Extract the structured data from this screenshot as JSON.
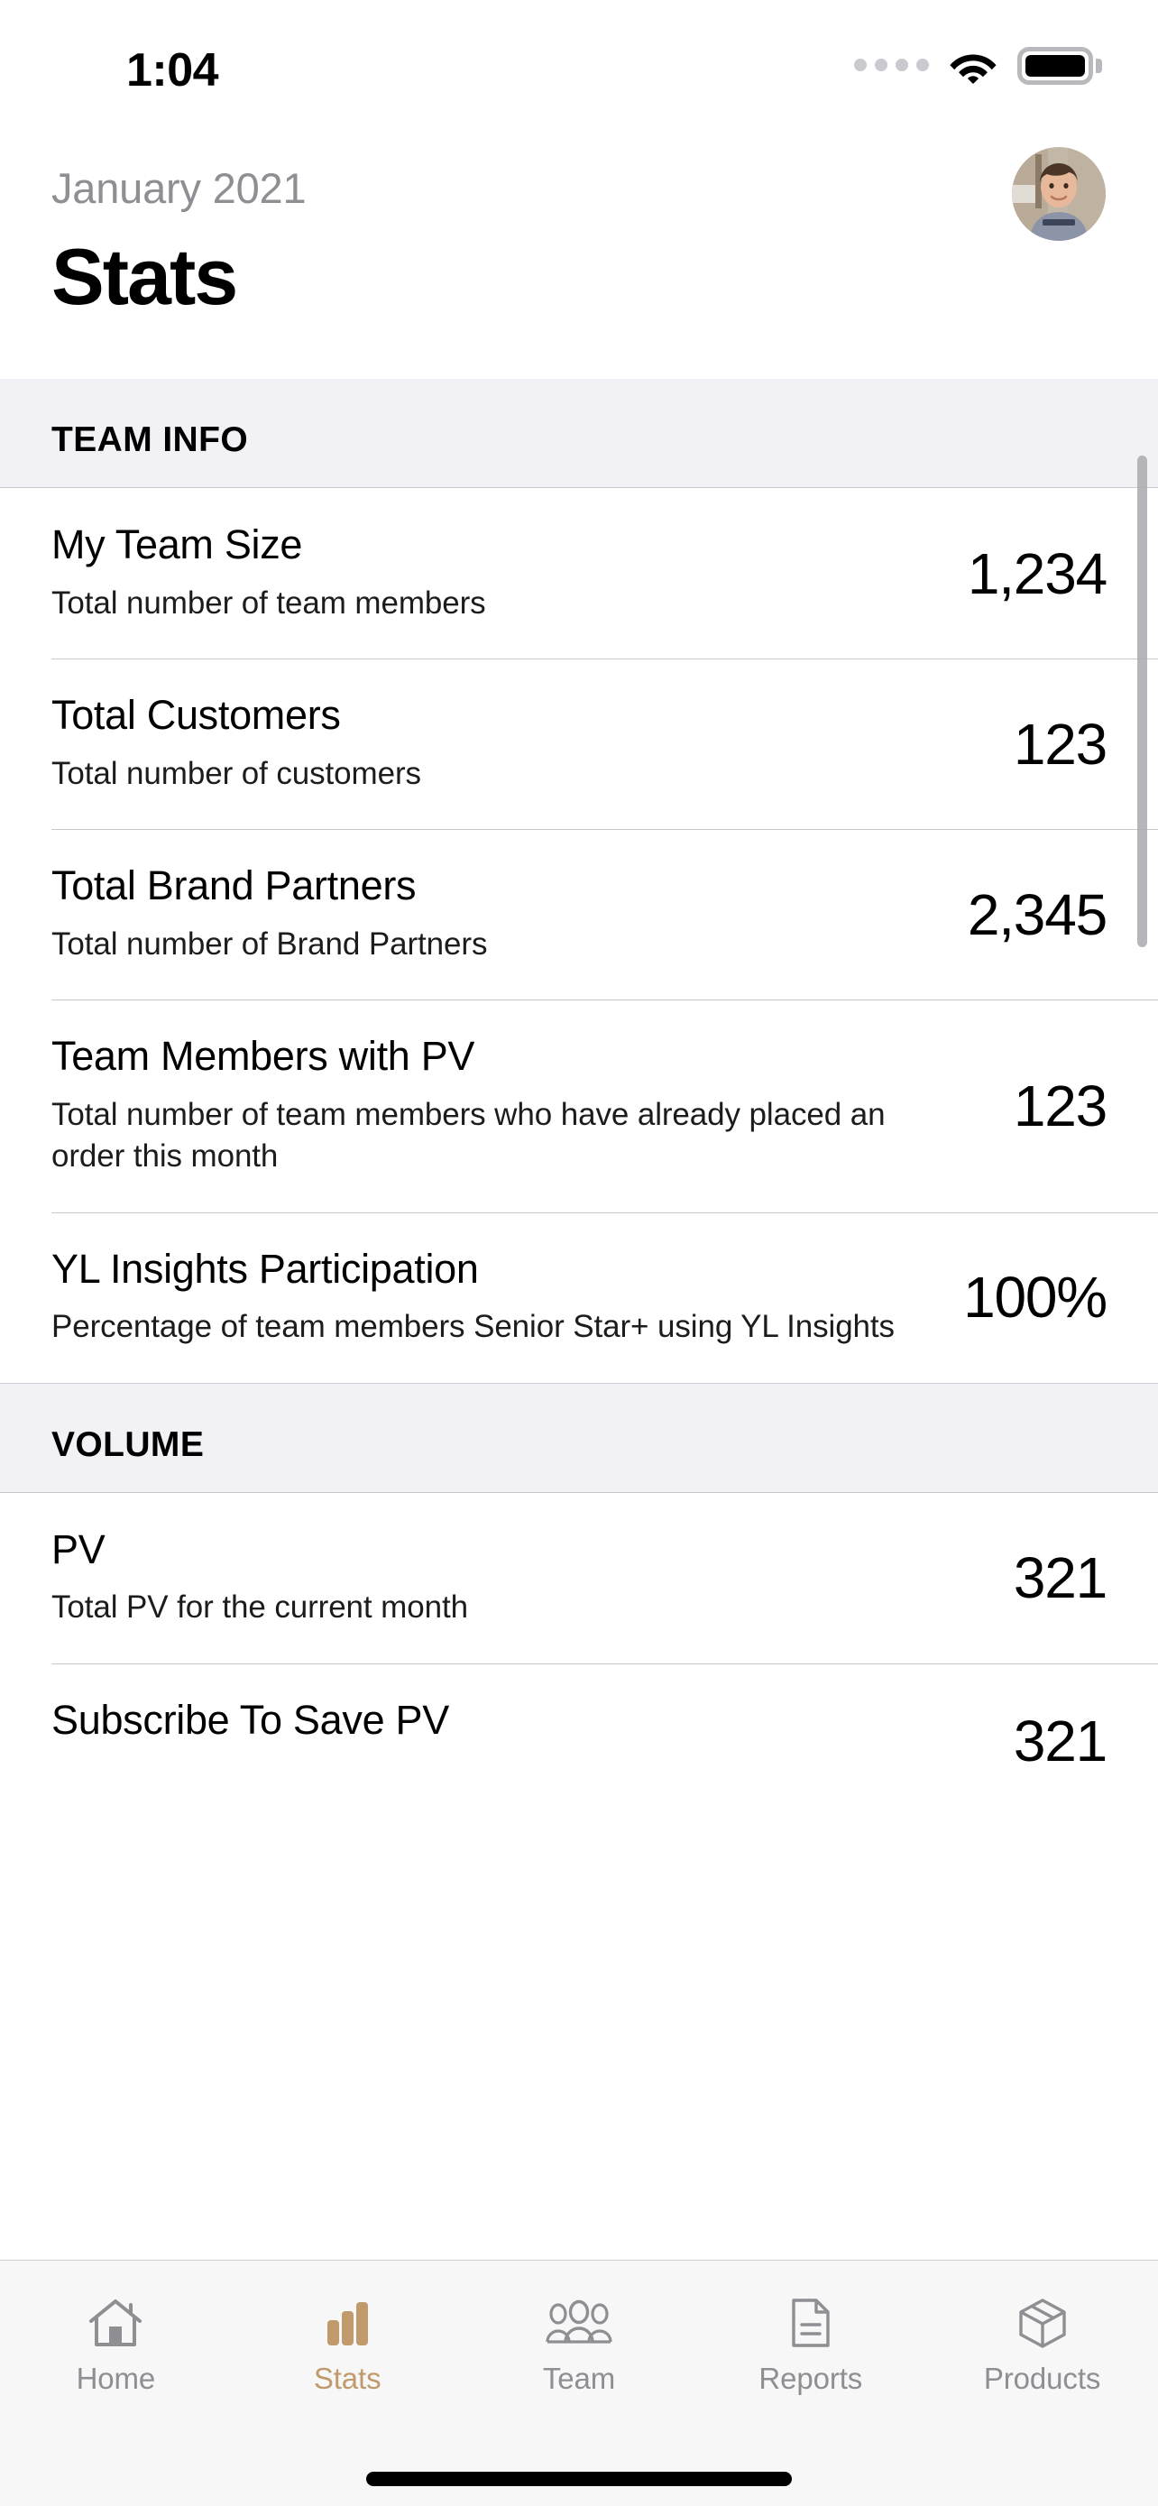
{
  "status_bar": {
    "time": "1:04",
    "signal_icon": "signal-dots-icon",
    "wifi_icon": "wifi-icon",
    "battery_icon": "battery-full-icon"
  },
  "header": {
    "month": "January 2021",
    "title": "Stats",
    "avatar_name": "profile-avatar"
  },
  "sections": [
    {
      "id": "team-info",
      "header": "TEAM INFO",
      "rows": [
        {
          "title": "My Team Size",
          "subtitle": "Total number of team members",
          "value": "1,234"
        },
        {
          "title": "Total Customers",
          "subtitle": "Total number of customers",
          "value": "123"
        },
        {
          "title": "Total Brand Partners",
          "subtitle": "Total number of Brand Partners",
          "value": "2,345"
        },
        {
          "title": "Team Members with PV",
          "subtitle": "Total number of team members who have already placed an order this month",
          "value": "123"
        },
        {
          "title": "YL Insights Participation",
          "subtitle": "Percentage of team members Senior Star+ using YL Insights",
          "value": "100%"
        }
      ]
    },
    {
      "id": "volume",
      "header": "VOLUME",
      "rows": [
        {
          "title": "PV",
          "subtitle": "Total PV for the current month",
          "value": "321"
        },
        {
          "title": "Subscribe To Save PV",
          "subtitle": "",
          "value": "321"
        }
      ]
    }
  ],
  "tab_bar": {
    "active_color": "#c09a6b",
    "inactive_color": "#8e8e93",
    "tabs": [
      {
        "label": "Home",
        "icon": "home-icon",
        "active": false
      },
      {
        "label": "Stats",
        "icon": "bar-chart-icon",
        "active": true
      },
      {
        "label": "Team",
        "icon": "people-icon",
        "active": false
      },
      {
        "label": "Reports",
        "icon": "document-icon",
        "active": false
      },
      {
        "label": "Products",
        "icon": "box-icon",
        "active": false
      }
    ]
  }
}
